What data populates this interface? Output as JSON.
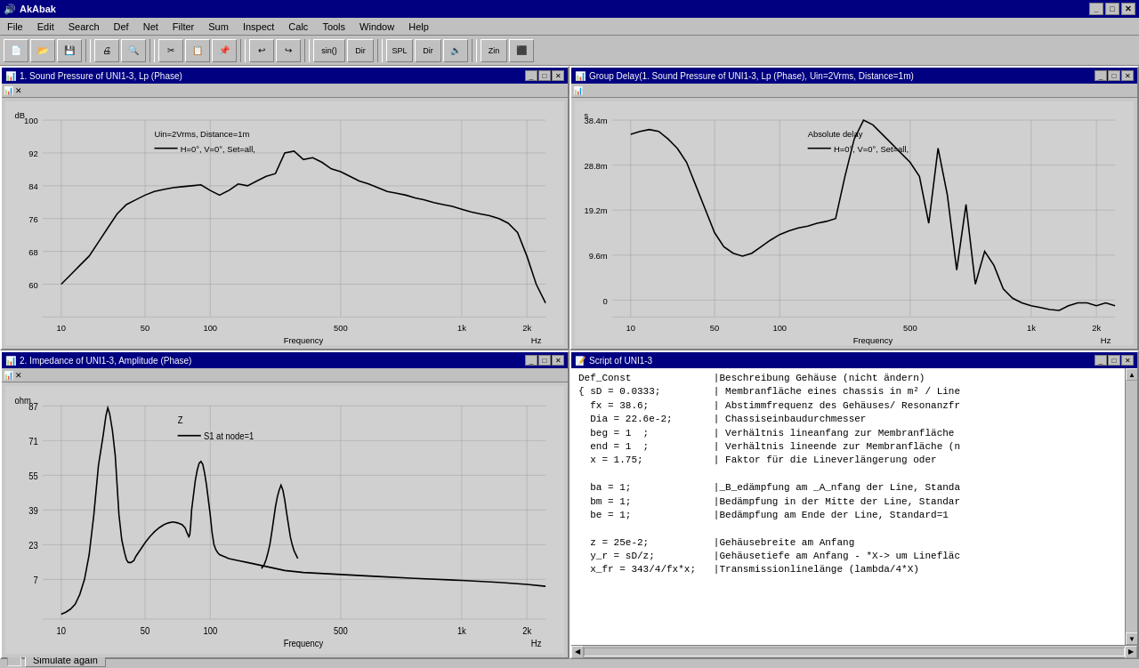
{
  "app": {
    "title": "AkAbak",
    "title_icon": "🔊"
  },
  "title_bar": {
    "controls": [
      "-",
      "□",
      "✕"
    ]
  },
  "menu": {
    "items": [
      "File",
      "Edit",
      "Search",
      "Def",
      "Net",
      "Filter",
      "Sum",
      "Inspect",
      "Calc",
      "Tools",
      "Window",
      "Help"
    ]
  },
  "panels": {
    "sound_pressure": {
      "title": "1. Sound Pressure of UNI1-3, Lp (Phase)",
      "subtitle_line1": "Uin=2Vrms, Distance=1m",
      "subtitle_line2": "— H=0°, V=0°, Set=all,",
      "ylabel": "dB",
      "y_values": [
        "100",
        "92",
        "84",
        "76",
        "68",
        "60"
      ],
      "x_values": [
        "10",
        "50",
        "100",
        "500",
        "1k",
        "2k"
      ],
      "xlabel": "Frequency",
      "xunit": "Hz"
    },
    "group_delay": {
      "title": "Group Delay(1. Sound Pressure of UNI1-3, Lp (Phase), Uin=2Vrms, Distance=1m)",
      "subtitle": "Absolute delay",
      "subtitle_line2": "— H=0°, V=0°, Set=all,",
      "ylabel": "s",
      "y_values": [
        "38.4m",
        "28.8m",
        "19.2m",
        "9.6m",
        "0"
      ],
      "x_values": [
        "10",
        "50",
        "100",
        "500",
        "1k",
        "2k"
      ],
      "xlabel": "Frequency",
      "xunit": "Hz"
    },
    "impedance": {
      "title": "2. Impedance of UNI1-3, Amplitude (Phase)",
      "legend_z": "Z",
      "legend_s1": "— S1 at node=1",
      "ylabel": "ohm",
      "y_values": [
        "87",
        "71",
        "55",
        "39",
        "23",
        "7"
      ],
      "x_values": [
        "10",
        "50",
        "100",
        "500",
        "1k",
        "2k"
      ],
      "xlabel": "Frequency",
      "xunit": "Hz"
    },
    "script": {
      "title": "Script of UNI1-3",
      "content": "Def_Const              |Beschreibung Gehäuse (nicht ändern)\n{ sD = 0.0333;         | Membranfläche eines chassis in m² / Line\n  fx = 38.6;           | Abstimmfrequenz des Gehäuses/ Resonanzfr\n  Dia = 22.6e-2;       | Chassiseinbaudurchmesser\n  beg = 1  ;           | Verhältnis lineanfang zur Membranfläche\n  end = 1  ;           | Verhältnis lineende zur Membranfläche (n\n  x = 1.75;            | Faktor für die Lineverlängerung oder\n\n  ba = 1;              |_B_edämpfung am _A_nfang der Line, Standa\n  bm = 1;              |Bedämpfung in der Mitte der Line, Standar\n  be = 1;              |Bedämpfung am Ende der Line, Standard=1\n\n  z = 25e-2;           |Gehäusebreite am Anfang\n  y_r = sD/z;          |Gehäusetiefe am Anfang - *X-> um Linefläc\n  x_fr = 343/4/fx*x;   |Transmissionlinelänge (lambda/4*X)"
    }
  },
  "status_bar": {
    "simulate_label": "Simulate again"
  }
}
